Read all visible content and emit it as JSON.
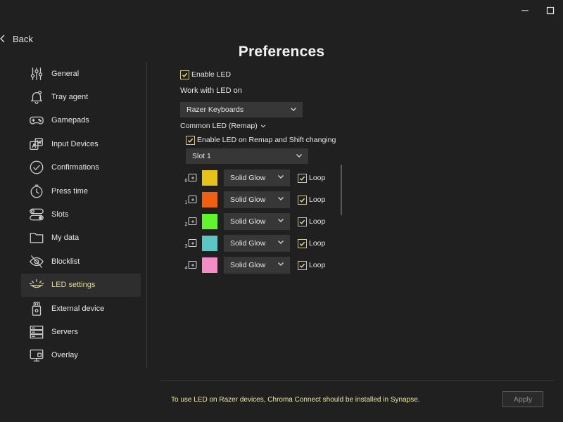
{
  "window": {
    "minimize_glyph": "—",
    "maximize_glyph": "☐"
  },
  "nav": {
    "back_label": "Back"
  },
  "page": {
    "title": "Preferences"
  },
  "sidebar": {
    "items": [
      {
        "label": "General",
        "icon": "sliders-icon"
      },
      {
        "label": "Tray agent",
        "icon": "bell-icon"
      },
      {
        "label": "Gamepads",
        "icon": "gamepad-icon"
      },
      {
        "label": "Input Devices",
        "icon": "keyboard-keys-icon"
      },
      {
        "label": "Confirmations",
        "icon": "check-circle-icon"
      },
      {
        "label": "Press time",
        "icon": "stopwatch-icon"
      },
      {
        "label": "Slots",
        "icon": "toggles-icon"
      },
      {
        "label": "My data",
        "icon": "folder-icon"
      },
      {
        "label": "Blocklist",
        "icon": "eye-off-icon"
      },
      {
        "label": "LED settings",
        "icon": "led-icon",
        "active": true
      },
      {
        "label": "External device",
        "icon": "usb-device-icon"
      },
      {
        "label": "Servers",
        "icon": "server-icon"
      },
      {
        "label": "Overlay",
        "icon": "monitor-icon"
      }
    ]
  },
  "led": {
    "enable_led_label": "Enable LED",
    "enable_led_checked": true,
    "work_with_label": "Work with LED on",
    "work_with_value": "Razer Keyboards",
    "common_led_label": "Common LED (Remap)",
    "enable_remap_label": "Enable LED on Remap and Shift changing",
    "enable_remap_checked": true,
    "slot_value": "Slot 1",
    "rows": [
      {
        "key": "0",
        "color": "#e8c21c",
        "effect": "Solid Glow",
        "loop_label": "Loop",
        "loop_checked": true
      },
      {
        "key": "1",
        "color": "#f06010",
        "effect": "Solid Glow",
        "loop_label": "Loop",
        "loop_checked": true
      },
      {
        "key": "2",
        "color": "#62f22e",
        "effect": "Solid Glow",
        "loop_label": "Loop",
        "loop_checked": true
      },
      {
        "key": "3",
        "color": "#5cc6c4",
        "effect": "Solid Glow",
        "loop_label": "Loop",
        "loop_checked": true
      },
      {
        "key": "4",
        "color": "#f48cc8",
        "effect": "Solid Glow",
        "loop_label": "Loop",
        "loop_checked": true
      }
    ]
  },
  "footer": {
    "note": "To use LED on Razer devices, Chroma Connect should be installed in Synapse.",
    "apply_label": "Apply"
  },
  "colors": {
    "accent": "#e2d79c",
    "background": "#202020",
    "panel": "#373737"
  }
}
